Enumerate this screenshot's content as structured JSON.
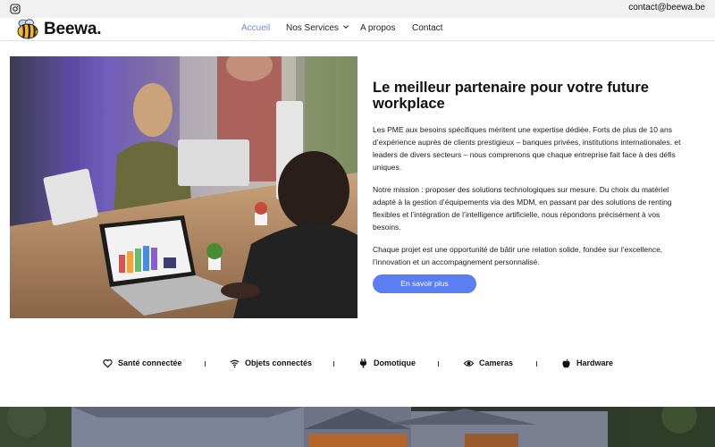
{
  "topbar": {
    "icon": "instagram-icon",
    "email": "contact@beewa.be"
  },
  "header": {
    "logo_icon": "bee-icon",
    "brand": "Beewa.",
    "nav": [
      {
        "label": "Accueil",
        "active": true
      },
      {
        "label": "Nos Services",
        "has_dropdown": true
      },
      {
        "label": "A propos"
      },
      {
        "label": "Contact"
      }
    ],
    "active_color": "#6f8de6"
  },
  "hero": {
    "image": "office-workspace-photo",
    "title": "Le meilleur partenaire pour votre future workplace",
    "paragraphs": [
      "Les PME aux besoins spécifiques méritent une expertise dédiée. Forts de plus de 10 ans d’expérience auprès de clients prestigieux – banques privées, institutions internationales, et leaders de divers secteurs – nous comprenons que chaque entreprise fait face à des défis uniques.",
      "Notre mission : proposer des solutions technologiques sur mesure. Du choix du matériel adapté à la gestion d’équipements via des MDM, en passant par des solutions de renting flexibles et l’intégration de l’intelligence artificielle, nous répondons précisément à vos besoins.",
      "Chaque projet est une opportunité de bâtir une relation solide, fondée sur l’excellence, l’innovation et un accompagnement personnalisé."
    ],
    "cta_label": "En savoir plus",
    "cta_color": "#5b7ef2"
  },
  "features": [
    {
      "label": "Santé connectée",
      "icon": "heart-icon"
    },
    {
      "label": "Objets connectés",
      "icon": "wifi-icon"
    },
    {
      "label": "Domotique",
      "icon": "plug-icon"
    },
    {
      "label": "Cameras",
      "icon": "eye-icon"
    },
    {
      "label": "Hardware",
      "icon": "apple-icon"
    }
  ],
  "bottom": {
    "image": "house-photo"
  }
}
